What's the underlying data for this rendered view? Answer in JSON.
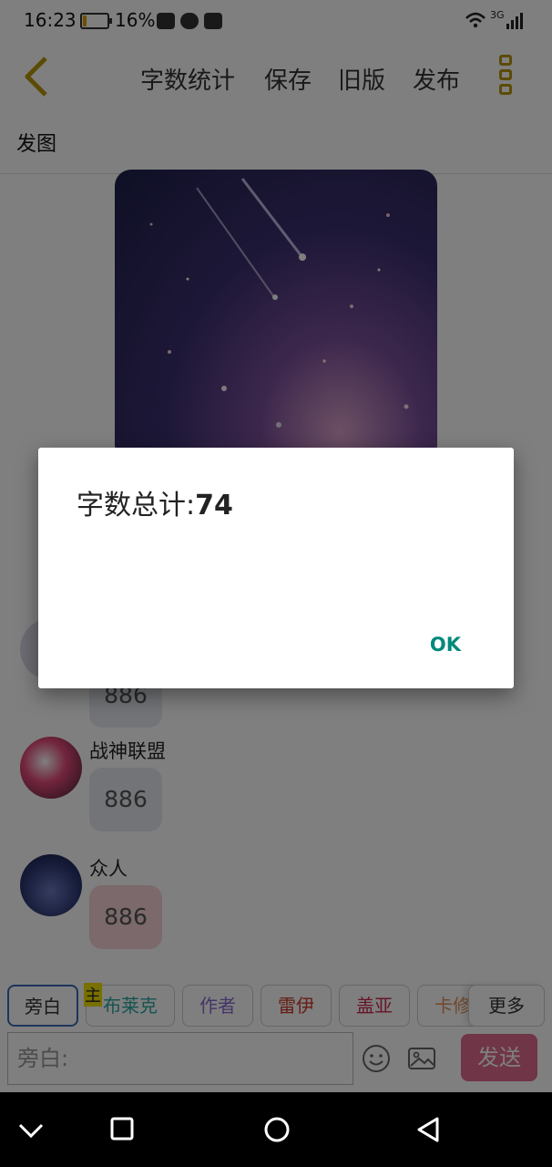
{
  "status_bar": {
    "time": "16:23",
    "battery_percent": "16%",
    "battery_level": 0.16,
    "network": "3G"
  },
  "toolbar": {
    "back_icon": "chevron-left-icon",
    "items": [
      "字数统计",
      "保存",
      "旧版",
      "发布"
    ],
    "menu_icon": "more-vert-icon",
    "accent_color": "#b8960a"
  },
  "section": {
    "title": "发图"
  },
  "messages": [
    {
      "sender": "",
      "text": "886",
      "bubble_color": "#e4e9ef"
    },
    {
      "sender": "战神联盟",
      "text": "886",
      "bubble_color": "#e4e9ef"
    },
    {
      "sender": "众人",
      "text": "886",
      "bubble_color": "#f6d3d7"
    }
  ],
  "roles": {
    "badge": "主",
    "chips": [
      {
        "label": "旁白",
        "color": "#333333"
      },
      {
        "label": "布莱克",
        "color": "#2aa8a0"
      },
      {
        "label": "作者",
        "color": "#8a6bd0"
      },
      {
        "label": "雷伊",
        "color": "#cc3a2a"
      },
      {
        "label": "盖亚",
        "color": "#cc2a50"
      },
      {
        "label": "卡修",
        "color": "#e0905a"
      }
    ],
    "more_label": "更多"
  },
  "input": {
    "placeholder": "旁白:",
    "send_label": "发送"
  },
  "dialog": {
    "label": "字数总计:",
    "count": "74",
    "ok_label": "OK"
  }
}
